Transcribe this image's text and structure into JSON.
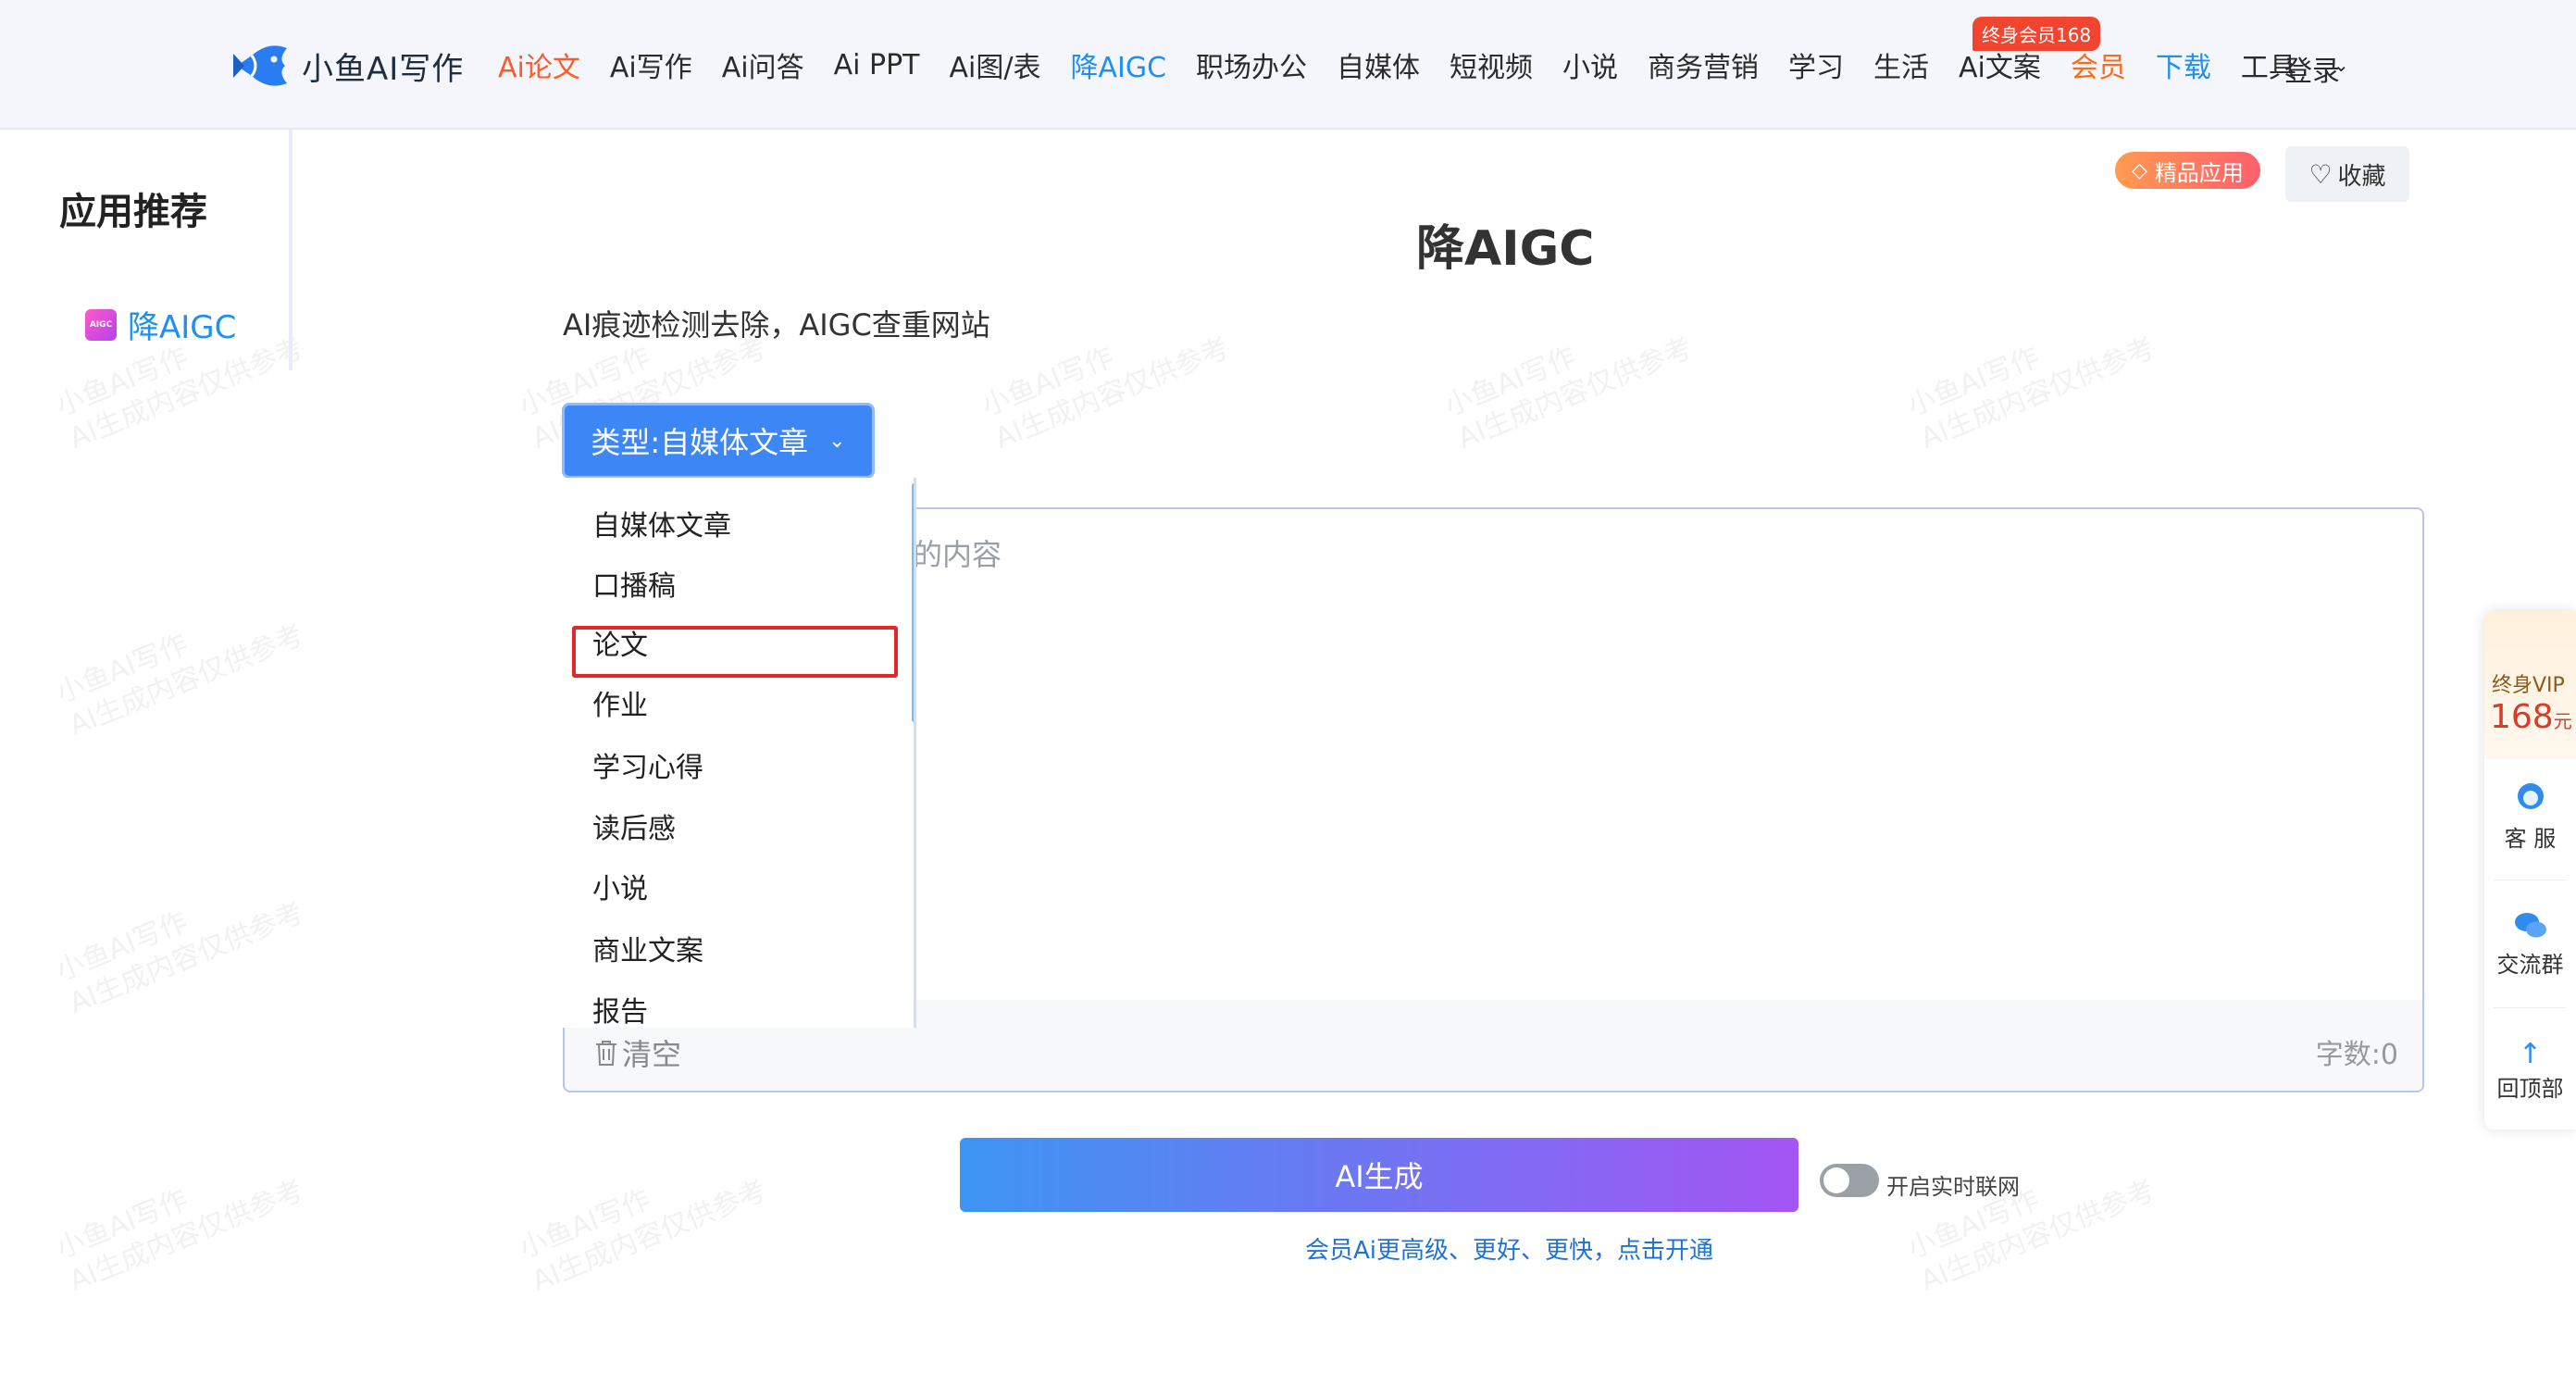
{
  "header": {
    "logo_text": "小鱼AI写作",
    "nav": [
      {
        "label": "Ai论文",
        "style": "red"
      },
      {
        "label": "Ai写作",
        "style": ""
      },
      {
        "label": "Ai问答",
        "style": ""
      },
      {
        "label": "Ai PPT",
        "style": ""
      },
      {
        "label": "Ai图/表",
        "style": ""
      },
      {
        "label": "降AIGC",
        "style": "blue"
      },
      {
        "label": "职场办公",
        "style": ""
      },
      {
        "label": "自媒体",
        "style": ""
      },
      {
        "label": "短视频",
        "style": ""
      },
      {
        "label": "小说",
        "style": ""
      },
      {
        "label": "商务营销",
        "style": ""
      },
      {
        "label": "学习",
        "style": ""
      },
      {
        "label": "生活",
        "style": ""
      },
      {
        "label": "Ai文案",
        "style": ""
      },
      {
        "label": "会员",
        "style": "vip"
      },
      {
        "label": "下载",
        "style": "blue"
      },
      {
        "label": "工具",
        "style": ""
      }
    ],
    "vip_badge": "终身会员168",
    "login": "登录"
  },
  "sidebar": {
    "title": "应用推荐",
    "items": [
      {
        "label": "降AIGC",
        "icon_text": "AIGC"
      }
    ]
  },
  "top_actions": {
    "premium": "精品应用",
    "favorite": "收藏"
  },
  "main": {
    "title": "降AIGC",
    "subtitle": "AI痕迹检测去除，AIGC查重网站",
    "type_button": "类型:自媒体文章",
    "editor_placeholder_visible": "的内容",
    "clear": "清空",
    "char_count": "字数:0",
    "generate": "AI生成",
    "realtime_toggle": "开启实时联网",
    "vip_link": "会员Ai更高级、更好、更快，点击开通"
  },
  "dropdown": {
    "options": [
      "自媒体文章",
      "口播稿",
      "论文",
      "作业",
      "学习心得",
      "读后感",
      "小说",
      "商业文案",
      "报告"
    ],
    "highlighted": "论文"
  },
  "float_panel": {
    "vip_line1": "终身VIP",
    "vip_price": "168",
    "vip_unit": "元",
    "service": "客 服",
    "group": "交流群",
    "top": "回顶部"
  },
  "watermark": {
    "line1": "小鱼AI写作",
    "line2": "AI生成内容仅供参考"
  },
  "colors": {
    "accent_blue": "#3c86f5",
    "nav_red": "#ff5a2a",
    "highlight_red": "#e8242b"
  }
}
